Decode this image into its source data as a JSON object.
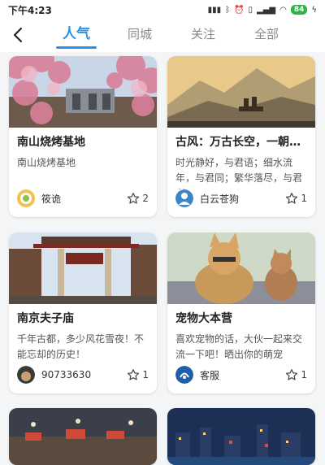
{
  "status_bar": {
    "time": "下午4:23",
    "signal_text": "ııl",
    "battery": "84",
    "colors": {
      "battery": "#2db54a"
    }
  },
  "nav": {
    "back_icon": "chevron-left-icon",
    "tabs": [
      {
        "label": "人气",
        "active": true
      },
      {
        "label": "同城",
        "active": false
      },
      {
        "label": "关注",
        "active": false
      },
      {
        "label": "全部",
        "active": false
      }
    ],
    "accent": "#2a90e8"
  },
  "cards": [
    {
      "title": "南山烧烤基地",
      "desc": "南山烧烤基地",
      "user": "筱诡",
      "likes": "2",
      "image": "cherry-blossom-gate-photo"
    },
    {
      "title": "古风：万古长空，一朝风月",
      "desc": "时光静好，与君语；细水流年，与君同；繁华落尽，与君老",
      "user": "白云苍狗",
      "likes": "1",
      "image": "ancient-landscape-painting"
    },
    {
      "title": "南京夫子庙",
      "desc": "千年古都，多少风花雪夜！不能忘却的历史！",
      "user": "90733630",
      "likes": "1",
      "image": "temple-gate-photo"
    },
    {
      "title": "宠物大本营",
      "desc": "喜欢宠物的话，大伙一起来交流一下吧！晒出你的萌宠",
      "user": "客服",
      "likes": "1",
      "image": "dog-and-cat-photo"
    },
    {
      "image": "night-market-photo"
    },
    {
      "image": "city-night-skyline-photo"
    }
  ]
}
